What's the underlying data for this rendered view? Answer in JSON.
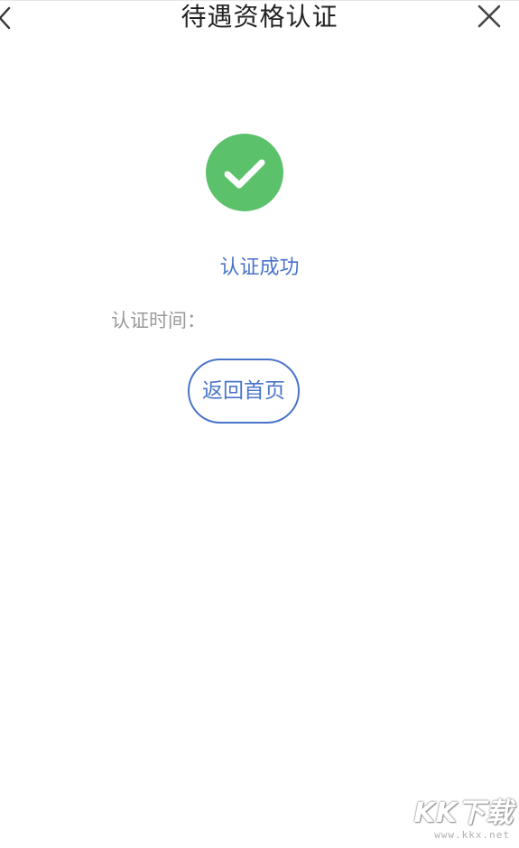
{
  "header": {
    "title": "待遇资格认证",
    "back_icon": "chevron-left-icon",
    "close_icon": "close-icon"
  },
  "result": {
    "icon": "check-circle-icon",
    "icon_color": "#5cc16b",
    "status_text": "认证成功",
    "accent_color": "#4a74c9"
  },
  "details": {
    "time_label": "认证时间：",
    "time_value": ""
  },
  "actions": {
    "home_button_label": "返回首页"
  },
  "watermark": {
    "logo_text": "KK下载",
    "url": "www.kkx.net"
  }
}
